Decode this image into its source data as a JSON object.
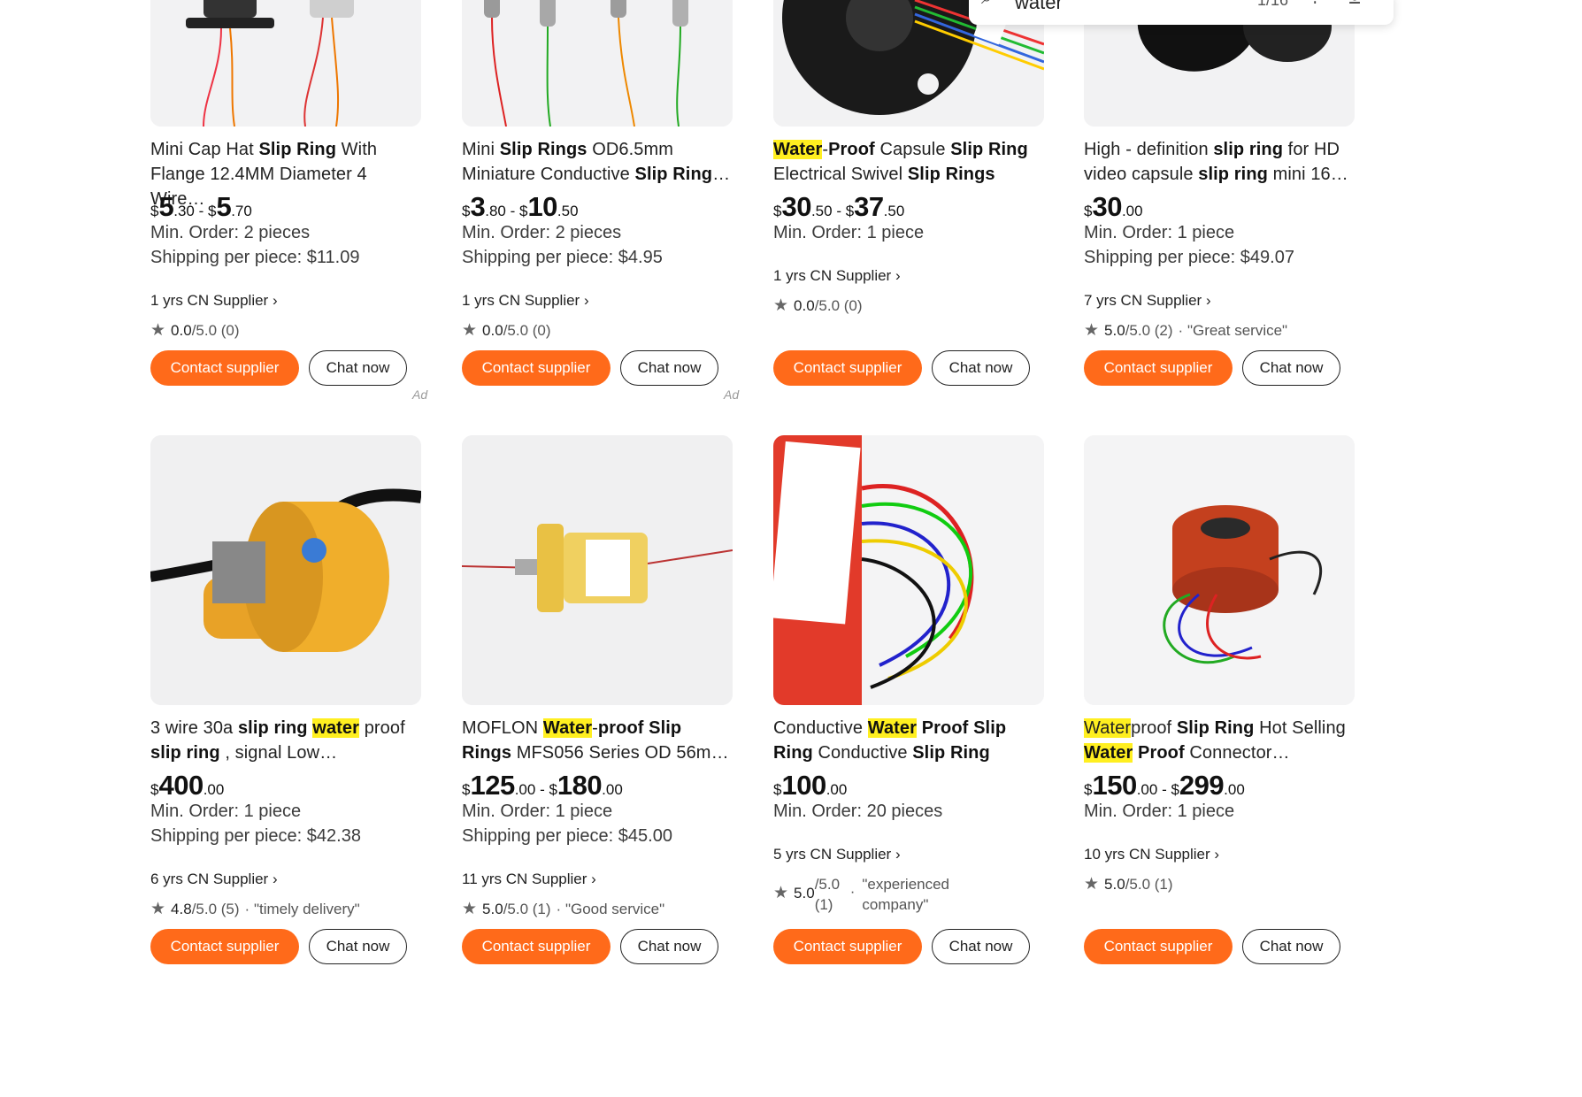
{
  "find_bar": {
    "query": "water",
    "count": "1/16"
  },
  "products": [
    {
      "title_html": "Mini Cap Hat <b>Slip Ring</b> With Flange 12.4MM Diameter 4 Wire…",
      "price": {
        "a_int": "5",
        "a_dec": ".30",
        "sep": " - ",
        "b_int": "5",
        "b_dec": ".70"
      },
      "min_order": "Min. Order: 2 pieces",
      "shipping": "Shipping per piece: $11.09",
      "supplier": "1 yrs CN Supplier",
      "rating": "0.0",
      "rating_of": "/5.0 (0)",
      "review": "",
      "contact": "Contact supplier",
      "chat": "Chat now",
      "ad": "Ad"
    },
    {
      "title_html": "Mini <b>Slip Rings</b> OD6.5mm Miniature Conductive <b>Slip Ring</b>…",
      "price": {
        "a_int": "3",
        "a_dec": ".80",
        "sep": " - ",
        "b_int": "10",
        "b_dec": ".50"
      },
      "min_order": "Min. Order: 2 pieces",
      "shipping": "Shipping per piece: $4.95",
      "supplier": "1 yrs CN Supplier",
      "rating": "0.0",
      "rating_of": "/5.0 (0)",
      "review": "",
      "contact": "Contact supplier",
      "chat": "Chat now",
      "ad": "Ad"
    },
    {
      "title_html": "<b class=\"hl\">Water</b>-<b>Proof</b> Capsule <b>Slip Ring</b> Electrical Swivel <b>Slip Rings</b>",
      "price": {
        "a_int": "30",
        "a_dec": ".50",
        "sep": " - ",
        "b_int": "37",
        "b_dec": ".50"
      },
      "min_order": "Min. Order: 1 piece",
      "shipping": "",
      "supplier": "1 yrs CN Supplier",
      "rating": "0.0",
      "rating_of": "/5.0 (0)",
      "review": "",
      "contact": "Contact supplier",
      "chat": "Chat now",
      "ad": ""
    },
    {
      "title_html": "High - definition <b>slip ring</b> for HD video capsule <b>slip ring</b> mini 16…",
      "price": {
        "a_int": "30",
        "a_dec": ".00",
        "sep": "",
        "b_int": "",
        "b_dec": ""
      },
      "min_order": "Min. Order: 1 piece",
      "shipping": "Shipping per piece: $49.07",
      "supplier": "7 yrs CN Supplier",
      "rating": "5.0",
      "rating_of": "/5.0 (2)",
      "review": "\"Great service\"",
      "contact": "Contact supplier",
      "chat": "Chat now",
      "ad": ""
    },
    {
      "title_html": "3 wire 30a <b>slip ring</b> <b class=\"hl\">water</b> proof <b>slip ring</b> , signal Low…",
      "price": {
        "a_int": "400",
        "a_dec": ".00",
        "sep": "",
        "b_int": "",
        "b_dec": ""
      },
      "min_order": "Min. Order: 1 piece",
      "shipping": "Shipping per piece: $42.38",
      "supplier": "6 yrs CN Supplier",
      "rating": "4.8",
      "rating_of": "/5.0 (5)",
      "review": "\"timely delivery\"",
      "contact": "Contact supplier",
      "chat": "Chat now",
      "ad": ""
    },
    {
      "title_html": "MOFLON <b class=\"hl\">Water</b>-<b>proof Slip Rings</b> MFS056 Series OD 56m…",
      "price": {
        "a_int": "125",
        "a_dec": ".00",
        "sep": " - ",
        "b_int": "180",
        "b_dec": ".00"
      },
      "min_order": "Min. Order: 1 piece",
      "shipping": "Shipping per piece: $45.00",
      "supplier": "11 yrs CN Supplier",
      "rating": "5.0",
      "rating_of": "/5.0 (1)",
      "review": "\"Good service\"",
      "contact": "Contact supplier",
      "chat": "Chat now",
      "ad": ""
    },
    {
      "title_html": "Conductive <b class=\"hl\">Water</b> <b>Proof Slip Ring</b> Conductive <b>Slip Ring</b>",
      "price": {
        "a_int": "100",
        "a_dec": ".00",
        "sep": "",
        "b_int": "",
        "b_dec": ""
      },
      "min_order": "Min. Order: 20 pieces",
      "shipping": "",
      "supplier": "5 yrs CN Supplier",
      "rating": "5.0",
      "rating_of": "/5.0 (1)",
      "review": "\"experienced company\"",
      "contact": "Contact supplier",
      "chat": "Chat now",
      "ad": ""
    },
    {
      "title_html": "<span class=\"hl\">Water</span>proof <b>Slip Ring</b> Hot Selling <b class=\"hl\">Water</b> <b>Proof</b> Connector…",
      "price": {
        "a_int": "150",
        "a_dec": ".00",
        "sep": " - ",
        "b_int": "299",
        "b_dec": ".00"
      },
      "min_order": "Min. Order: 1 piece",
      "shipping": "",
      "supplier": "10 yrs CN Supplier",
      "rating": "5.0",
      "rating_of": "/5.0 (1)",
      "review": "",
      "contact": "Contact supplier",
      "chat": "Chat now",
      "ad": ""
    }
  ],
  "colors": {
    "accent": "#ff6a1a",
    "highlight": "#ffef20",
    "image_bg": "#f0f0f1"
  }
}
